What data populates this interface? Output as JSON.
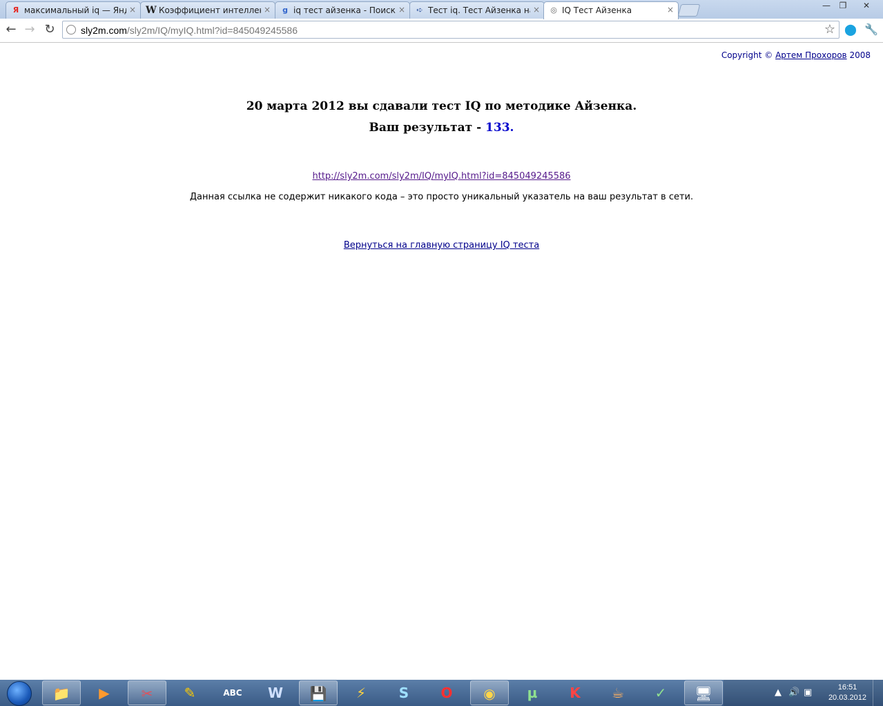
{
  "browser": {
    "tabs": [
      {
        "title": "максимальный iq — Яндекс",
        "favicon": "Я",
        "favcolor": "#e52620",
        "close": "×"
      },
      {
        "title": "Коэффициент интеллекта",
        "favicon": "W",
        "favcolor": "#000000",
        "close": "×"
      },
      {
        "title": "iq тест айзенка - Поиск в Google",
        "favicon": "g",
        "favcolor": "#3366cc",
        "close": "×"
      },
      {
        "title": "Тест iq. Тест Айзенка на уровень",
        "favicon": "➪",
        "favcolor": "#2a4f9c",
        "close": "×"
      },
      {
        "title": "IQ Тест Айзенка",
        "favicon": "◎",
        "favcolor": "#666666",
        "close": "×"
      }
    ],
    "window_controls": {
      "minimize": "—",
      "maximize": "❐",
      "close": "✕"
    },
    "nav": {
      "back": "←",
      "forward": "→",
      "reload": "↻"
    },
    "address": {
      "host": "sly2m.com",
      "path": "/sly2m/IQ/myIQ.html?id=845049245586"
    }
  },
  "page": {
    "copyright_prefix": "Copyright ©",
    "copyright_author": "Артем Прохоров",
    "copyright_year": "2008",
    "line1": "20 марта 2012 вы сдавали тест IQ по методике Айзенка.",
    "line2_prefix": "Ваш результат -",
    "score": "133.",
    "result_link": "http://sly2m.com/sly2m/IQ/myIQ.html?id=845049245586",
    "note": "Данная ссылка не содержит никакого кода – это просто уникальный указатель на ваш результат в сети.",
    "back_link": "Вернуться на главную страницу IQ теста"
  },
  "taskbar": {
    "apps": [
      {
        "name": "explorer",
        "glyph": "📁"
      },
      {
        "name": "media-player",
        "glyph": "▶"
      },
      {
        "name": "snipping-tool",
        "glyph": "✂"
      },
      {
        "name": "app-blue",
        "glyph": "✎"
      },
      {
        "name": "abc-dictionary",
        "glyph": "ABC"
      },
      {
        "name": "word",
        "glyph": "W"
      },
      {
        "name": "floppy-save",
        "glyph": "💾"
      },
      {
        "name": "winamp",
        "glyph": "⚡"
      },
      {
        "name": "skype",
        "glyph": "S"
      },
      {
        "name": "opera",
        "glyph": "O"
      },
      {
        "name": "chrome",
        "glyph": "◉"
      },
      {
        "name": "utorrent",
        "glyph": "µ"
      },
      {
        "name": "kaspersky",
        "glyph": "K"
      },
      {
        "name": "java",
        "glyph": "☕"
      },
      {
        "name": "notepad",
        "glyph": "✓"
      },
      {
        "name": "remote-desktop",
        "glyph": "🖥"
      }
    ],
    "time": "16:51",
    "date": "20.03.2012"
  }
}
